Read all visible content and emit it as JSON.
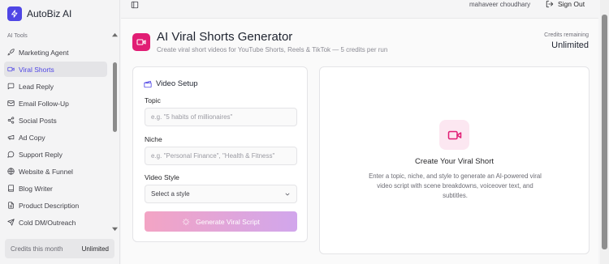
{
  "app": {
    "name": "AutoBiz AI"
  },
  "sidebar": {
    "section_label": "AI Tools",
    "items": [
      {
        "label": "Marketing Agent",
        "icon": "rocket-icon",
        "active": false
      },
      {
        "label": "Viral Shorts",
        "icon": "video-icon",
        "active": true
      },
      {
        "label": "Lead Reply",
        "icon": "reply-icon",
        "active": false
      },
      {
        "label": "Email Follow-Up",
        "icon": "mail-icon",
        "active": false
      },
      {
        "label": "Social Posts",
        "icon": "share-icon",
        "active": false
      },
      {
        "label": "Ad Copy",
        "icon": "megaphone-icon",
        "active": false
      },
      {
        "label": "Support Reply",
        "icon": "chat-icon",
        "active": false
      },
      {
        "label": "Website & Funnel",
        "icon": "globe-icon",
        "active": false
      },
      {
        "label": "Blog Writer",
        "icon": "book-icon",
        "active": false
      },
      {
        "label": "Product Description",
        "icon": "document-icon",
        "active": false
      },
      {
        "label": "Cold DM/Outreach",
        "icon": "send-icon",
        "active": false
      }
    ],
    "credits": {
      "label": "Credits this month",
      "value": "Unlimited"
    }
  },
  "topbar": {
    "user_name": "mahaveer choudhary",
    "sign_out": "Sign Out"
  },
  "header": {
    "title": "AI Viral Shorts Generator",
    "subtitle": "Create viral short videos for YouTube Shorts, Reels & TikTok — 5 credits per run",
    "credits_label": "Credits remaining",
    "credits_value": "Unlimited"
  },
  "setup": {
    "title": "Video Setup",
    "topic": {
      "label": "Topic",
      "placeholder": "e.g. \"5 habits of millionaires\"",
      "value": ""
    },
    "niche": {
      "label": "Niche",
      "placeholder": "e.g. \"Personal Finance\", \"Health & Fitness\"",
      "value": ""
    },
    "style": {
      "label": "Video Style",
      "selected": "Select a style"
    },
    "button": "Generate Viral Script"
  },
  "empty_state": {
    "title": "Create Your Viral Short",
    "description": "Enter a topic, niche, and style to generate an AI-powered viral video script with scene breakdowns, voiceover text, and subtitles."
  },
  "colors": {
    "accent": "#4f46e5",
    "brand_pink": "#e11d74"
  }
}
